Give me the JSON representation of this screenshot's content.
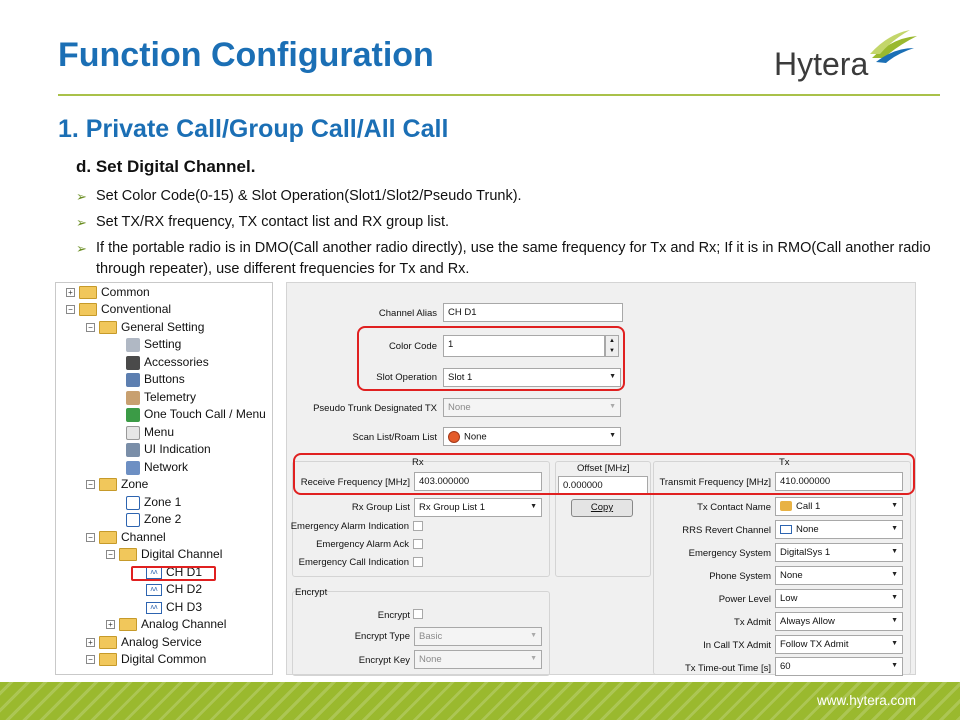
{
  "header": {
    "title": "Function Configuration",
    "logo_text": "Hytera"
  },
  "section": {
    "subtitle": "1. Private Call/Group Call/All Call",
    "step": "d. Set Digital Channel.",
    "bullets": [
      "Set Color Code(0-15) & Slot Operation(Slot1/Slot2/Pseudo Trunk).",
      "Set TX/RX frequency, TX contact list and RX group list.",
      "If the portable radio is in DMO(Call another radio directly), use the same frequency for Tx and Rx; If it is in RMO(Call another radio through repeater), use different frequencies for Tx and Rx."
    ]
  },
  "tree": {
    "items": [
      {
        "label": "Common"
      },
      {
        "label": "Conventional"
      },
      {
        "label": "General Setting"
      },
      {
        "label": "Setting"
      },
      {
        "label": "Accessories"
      },
      {
        "label": "Buttons"
      },
      {
        "label": "Telemetry"
      },
      {
        "label": "One Touch Call / Menu"
      },
      {
        "label": "Menu"
      },
      {
        "label": "UI Indication"
      },
      {
        "label": "Network"
      },
      {
        "label": "Zone"
      },
      {
        "label": "Zone 1"
      },
      {
        "label": "Zone 2"
      },
      {
        "label": "Channel"
      },
      {
        "label": "Digital Channel"
      },
      {
        "label": "CH D1"
      },
      {
        "label": "CH D2"
      },
      {
        "label": "CH D3"
      },
      {
        "label": "Analog Channel"
      },
      {
        "label": "Analog Service"
      },
      {
        "label": "Digital Common"
      }
    ]
  },
  "form": {
    "channel_alias_label": "Channel Alias",
    "channel_alias_value": "CH D1",
    "color_code_label": "Color Code",
    "color_code_value": "1",
    "slot_operation_label": "Slot Operation",
    "slot_operation_value": "Slot 1",
    "pseudo_trunk_label": "Pseudo Trunk Designated TX",
    "pseudo_trunk_value": "None",
    "scan_list_label": "Scan List/Roam List",
    "scan_list_value": "None",
    "rx_header": "Rx",
    "tx_header": "Tx",
    "offset_header": "Offset [MHz]",
    "receive_freq_label": "Receive Frequency [MHz]",
    "receive_freq_value": "403.000000",
    "offset_value": "0.000000",
    "transmit_freq_label": "Transmit Frequency [MHz]",
    "transmit_freq_value": "410.000000",
    "copy_label": "Copy",
    "rx_group_list_label": "Rx Group List",
    "rx_group_list_value": "Rx Group List 1",
    "emergency_alarm_indication_label": "Emergency Alarm Indication",
    "emergency_alarm_ack_label": "Emergency Alarm Ack",
    "emergency_call_indication_label": "Emergency Call Indication",
    "tx_contact_name_label": "Tx Contact Name",
    "tx_contact_name_value": "Call 1",
    "rrs_revert_label": "RRS Revert Channel",
    "rrs_revert_value": "None",
    "emergency_system_label": "Emergency System",
    "emergency_system_value": "DigitalSys 1",
    "phone_system_label": "Phone System",
    "phone_system_value": "None",
    "power_level_label": "Power Level",
    "power_level_value": "Low",
    "tx_admit_label": "Tx Admit",
    "tx_admit_value": "Always Allow",
    "in_call_tx_admit_label": "In Call TX Admit",
    "in_call_tx_admit_value": "Follow TX Admit",
    "tx_timeout_label": "Tx Time-out Time [s]",
    "tx_timeout_value": "60",
    "encrypt_group_title": "Encrypt",
    "encrypt_label": "Encrypt",
    "encrypt_type_label": "Encrypt Type",
    "encrypt_type_value": "Basic",
    "encrypt_key_label": "Encrypt Key",
    "encrypt_key_value": "None"
  },
  "footer": {
    "url": "www.hytera.com"
  },
  "colors": {
    "title_blue": "#1b6fb5",
    "accent_green": "#9ab92e",
    "highlight_red": "#e02020"
  }
}
